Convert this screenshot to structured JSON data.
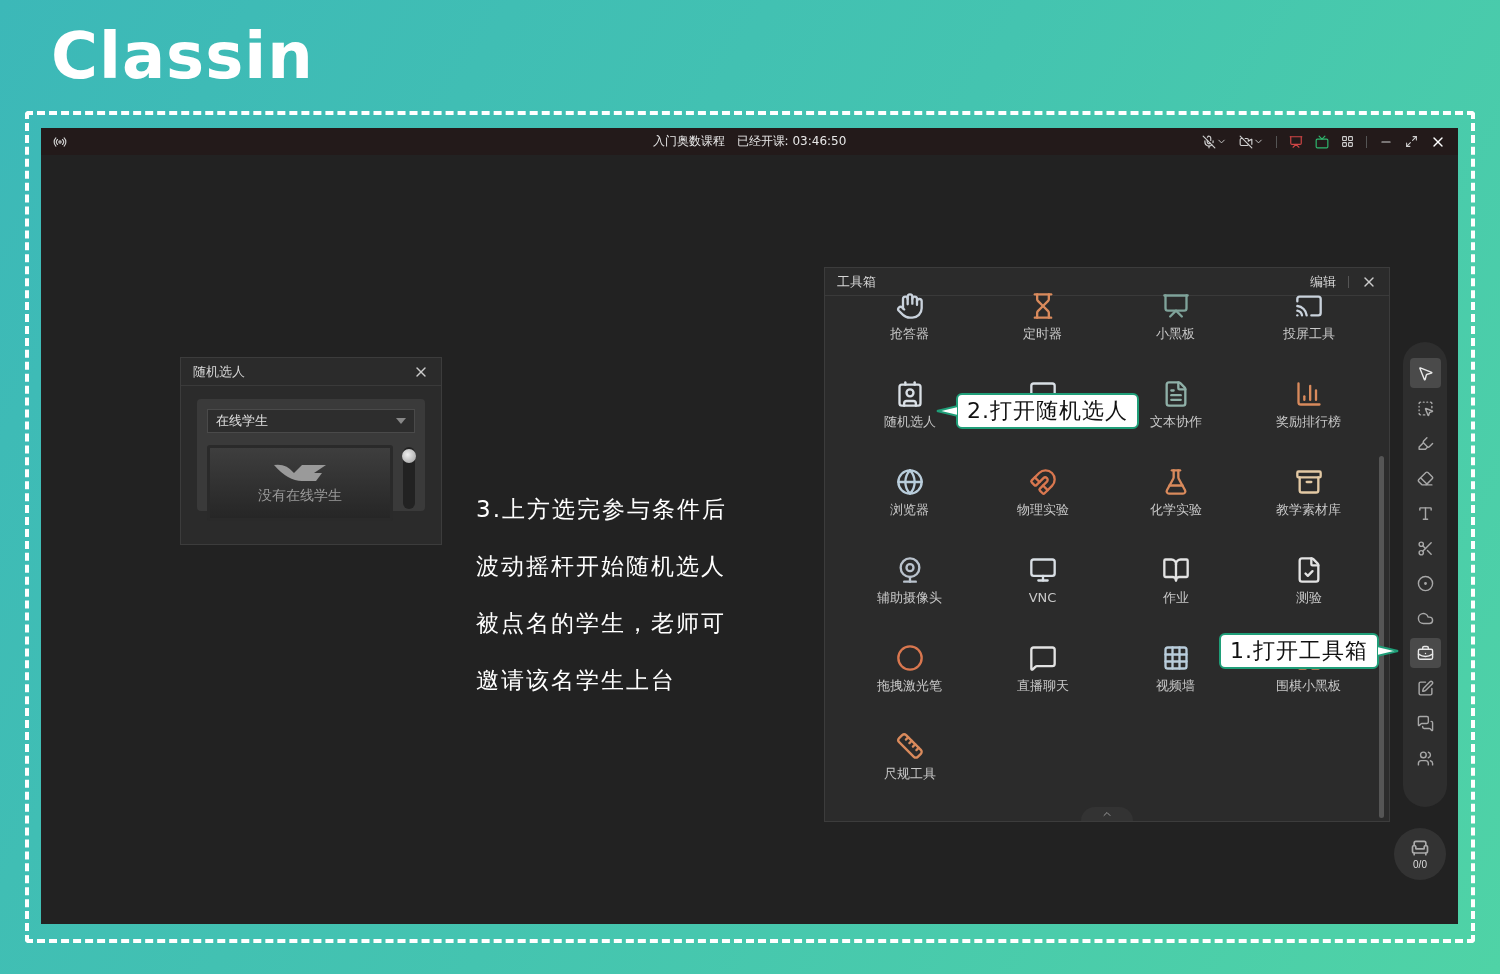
{
  "brand": {
    "logo": "Classin"
  },
  "window": {
    "title": "入门奥数课程",
    "timer": "已经开课: 03:46:50"
  },
  "picker": {
    "title": "随机选人",
    "dropdown": {
      "value": "在线学生"
    },
    "display": "没有在线学生"
  },
  "instructions": [
    "3.上方选完参与条件后",
    "波动摇杆开始随机选人",
    "被点名的学生，老师可",
    "邀请该名学生上台"
  ],
  "toolbox": {
    "title": "工具箱",
    "edit": "编辑",
    "items": [
      {
        "kind": "tool",
        "label": "抢答器"
      },
      {
        "kind": "tool",
        "label": "定时器"
      },
      {
        "kind": "tool",
        "label": "小黑板"
      },
      {
        "kind": "tool",
        "label": "投屏工具"
      },
      {
        "kind": "tool",
        "label": "随机选人"
      },
      {
        "kind": "covered"
      },
      {
        "kind": "tool",
        "label": "文本协作"
      },
      {
        "kind": "tool",
        "label": "奖励排行榜"
      },
      {
        "kind": "tool",
        "label": "浏览器"
      },
      {
        "kind": "tool",
        "label": "物理实验"
      },
      {
        "kind": "tool",
        "label": "化学实验"
      },
      {
        "kind": "tool",
        "label": "教学素材库"
      },
      {
        "kind": "tool",
        "label": "辅助摄像头"
      },
      {
        "kind": "tool",
        "label": "VNC"
      },
      {
        "kind": "tool",
        "label": "作业"
      },
      {
        "kind": "tool",
        "label": "测验"
      },
      {
        "kind": "tool",
        "label": "拖拽激光笔"
      },
      {
        "kind": "tool",
        "label": "直播聊天"
      },
      {
        "kind": "tool",
        "label": "视频墙"
      },
      {
        "kind": "tool",
        "label": "围棋小黑板"
      },
      {
        "kind": "tool",
        "label": "尺规工具"
      }
    ]
  },
  "callouts": [
    {
      "text": "2.打开随机选人"
    },
    {
      "text": "1.打开工具箱"
    }
  ],
  "side_toolbar": {
    "tools": [
      {
        "selected": true
      },
      {
        "selected": false
      },
      {
        "selected": false
      },
      {
        "selected": false
      },
      {
        "selected": false
      },
      {
        "selected": false
      },
      {
        "selected": false
      },
      {
        "selected": false
      },
      {
        "selected": true
      },
      {
        "selected": false
      },
      {
        "selected": false
      },
      {
        "selected": false
      }
    ]
  },
  "seat": {
    "count": "0/0"
  }
}
